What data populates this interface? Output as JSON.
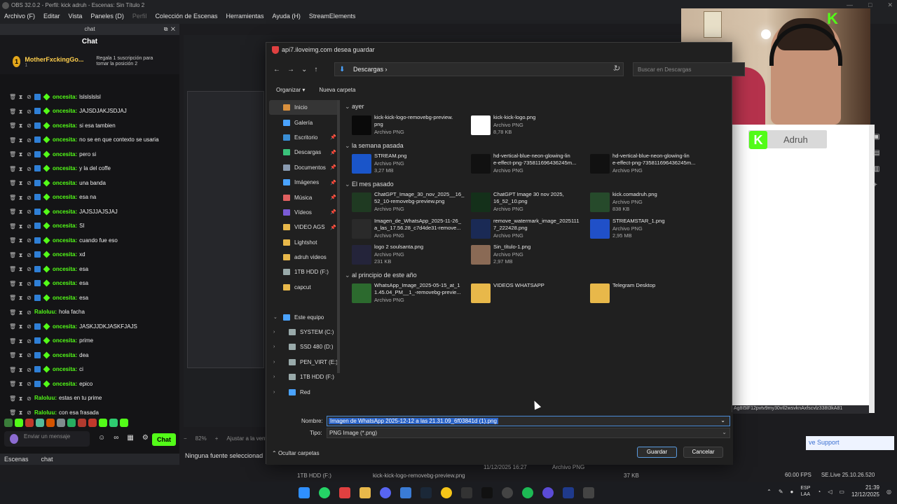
{
  "obs": {
    "title": "OBS 32.0.2 - Perfil: kick adruh - Escenas: Sin Título 2",
    "menu": [
      "Archivo (F)",
      "Editar",
      "Vista",
      "Paneles (D)",
      "Perfil",
      "Colección de Escenas",
      "Herramientas",
      "Ayuda (H)",
      "StreamElements"
    ]
  },
  "chat_dock": {
    "dock_title": "chat",
    "header": "Chat",
    "gift": {
      "user": "MotherFxckingGo...",
      "sub": "1",
      "message": "Regala 1 suscripción para tomar la posición 2"
    },
    "messages": [
      {
        "user": "oncesita:",
        "text": "lslslslslsl"
      },
      {
        "user": "oncesita:",
        "text": "JAJSDJAKJSDJAJ"
      },
      {
        "user": "oncesita:",
        "text": "si esa tambien"
      },
      {
        "user": "oncesita:",
        "text": "no se en que contexto se usaria"
      },
      {
        "user": "oncesita:",
        "text": "pero si"
      },
      {
        "user": "oncesita:",
        "text": "y la del coffe"
      },
      {
        "user": "oncesita:",
        "text": "una banda"
      },
      {
        "user": "oncesita:",
        "text": "esa na"
      },
      {
        "user": "oncesita:",
        "text": "JAJSJJAJSJAJ"
      },
      {
        "user": "oncesita:",
        "text": "SI"
      },
      {
        "user": "oncesita:",
        "text": "cuando fue eso"
      },
      {
        "user": "oncesita:",
        "text": "xd"
      },
      {
        "user": "oncesita:",
        "text": "esa"
      },
      {
        "user": "oncesita:",
        "text": "esa"
      },
      {
        "user": "oncesita:",
        "text": "esa"
      },
      {
        "user": "Raloluu:",
        "text": "hola facha"
      },
      {
        "user": "oncesita:",
        "text": "JASKJJDKJASKFJAJS"
      },
      {
        "user": "oncesita:",
        "text": "prime"
      },
      {
        "user": "oncesita:",
        "text": "dea"
      },
      {
        "user": "oncesita:",
        "text": "ci"
      },
      {
        "user": "oncesita:",
        "text": "epico"
      },
      {
        "user": "Raloluu:",
        "text": "estas en tu prime"
      },
      {
        "user": "Raloluu:",
        "text": "con esa frasada"
      }
    ],
    "input_placeholder": "Enviar un mensaje",
    "send_label": "Chat",
    "tabs": [
      "Escenas",
      "chat"
    ]
  },
  "preview": {
    "zoom": "82%",
    "fit_label": "Ajustar a la venta",
    "no_source": "Ninguna fuente seleccionad"
  },
  "right_panel": {
    "kick_name": "Adruh",
    "hash": "Ag8I5lF12pvtv9my30vIl2wsvknAxfscvlz338t3kA81",
    "support": "ve Support"
  },
  "stats": {
    "fps": "60.00 FPS",
    "version": "SE.Live 25.10.26.520"
  },
  "dialog": {
    "title": "api7.iloveimg.com desea guardar",
    "path": "Descargas",
    "search_placeholder": "Buscar en Descargas",
    "organize": "Organizar",
    "new_folder": "Nueva carpeta",
    "nav": [
      {
        "label": "Inicio",
        "icon": "home-icon",
        "pin": false
      },
      {
        "label": "Galería",
        "icon": "gallery-icon",
        "pin": false
      },
      {
        "label": "Escritorio",
        "icon": "desktop-icon",
        "pin": true
      },
      {
        "label": "Descargas",
        "icon": "download-icon",
        "pin": true
      },
      {
        "label": "Documentos",
        "icon": "documents-icon",
        "pin": true
      },
      {
        "label": "Imágenes",
        "icon": "pictures-icon",
        "pin": true
      },
      {
        "label": "Música",
        "icon": "music-icon",
        "pin": true
      },
      {
        "label": "Vídeos",
        "icon": "videos-icon",
        "pin": true
      },
      {
        "label": "VIDEO AGS",
        "icon": "folder-icon",
        "pin": true
      },
      {
        "label": "Lightshot",
        "icon": "folder-icon",
        "pin": false
      },
      {
        "label": "adruh videos",
        "icon": "folder-icon",
        "pin": false
      },
      {
        "label": "1TB HDD (F:)",
        "icon": "drive-icon",
        "pin": false
      },
      {
        "label": "capcut",
        "icon": "folder-icon",
        "pin": false
      },
      {
        "label": "",
        "icon": "",
        "pin": false
      },
      {
        "label": "Este equipo",
        "icon": "computer-icon",
        "pin": false
      },
      {
        "label": "SYSTEM (C:)",
        "icon": "drive-icon",
        "pin": false
      },
      {
        "label": "SSD 480 (D:)",
        "icon": "drive-icon",
        "pin": false
      },
      {
        "label": "PEN_VIRT (E:)",
        "icon": "drive-icon",
        "pin": false
      },
      {
        "label": "1TB HDD (F:)",
        "icon": "drive-icon",
        "pin": false
      },
      {
        "label": "Red",
        "icon": "network-icon",
        "pin": false
      }
    ],
    "groups": [
      {
        "label": "ayer"
      },
      {
        "label": "la semana pasada"
      },
      {
        "label": "El mes pasado"
      },
      {
        "label": "al principio de este año"
      }
    ],
    "files": [
      {
        "name": "kick-kick-logo-removebg-preview.\npng",
        "type": "Archivo PNG",
        "size": "",
        "color": "#0a0a0a"
      },
      {
        "name": "kick-kick-logo.png",
        "type": "Archivo PNG",
        "size": "8,78 KB",
        "color": "#ffffff"
      },
      {
        "name": "STREAM.png",
        "type": "Archivo PNG",
        "size": "3,27 MB",
        "color": "#1a55c9"
      },
      {
        "name": "hd-vertical-blue-neon-glowing-lin\ne-effect-png-735811696436245m...",
        "type": "Archivo PNG",
        "size": "",
        "color": "#111111"
      },
      {
        "name": "hd-vertical-blue-neon-glowing-lin\ne-effect-png-735811696436245m...",
        "type": "Archivo PNG",
        "size": "",
        "color": "#111111"
      },
      {
        "name": "ChatGPT_Image_30_nov_2025__16_\n52_10-removebg-preview.png",
        "type": "Archivo PNG",
        "size": "",
        "color": "#1f3a22"
      },
      {
        "name": "ChatGPT Image 30 nov 2025,\n16_52_10.png",
        "type": "Archivo PNG",
        "size": "",
        "color": "#14301a"
      },
      {
        "name": "kick.comadruh.png",
        "type": "Archivo PNG",
        "size": "838 KB",
        "color": "#264a2b"
      },
      {
        "name": "Imagen_de_WhatsApp_2025-11-26_\na_las_17.56.28_c7d4de31-remove...",
        "type": "Archivo PNG",
        "size": "",
        "color": "#2a2a2a"
      },
      {
        "name": "remove_watermark_image_2025111\n7_222428.png",
        "type": "Archivo PNG",
        "size": "",
        "color": "#1a2a55"
      },
      {
        "name": "STREAMSTAR_1.png",
        "type": "Archivo PNG",
        "size": "2,95 MB",
        "color": "#2050c8"
      },
      {
        "name": "logo 2 soulsanta.png",
        "type": "Archivo PNG",
        "size": "231 KB",
        "color": "#24243a"
      },
      {
        "name": "Sin_título-1.png",
        "type": "Archivo PNG",
        "size": "2,97 MB",
        "color": "#8a6a55"
      },
      {
        "name": "WhatsApp_Image_2025-05-15_at_1\n1.45.04_PM__1_-removebg-previe...",
        "type": "Archivo PNG",
        "size": "",
        "color": "#2c6a2e"
      },
      {
        "name": "VIDEOS WHATSAPP",
        "type": "",
        "size": "",
        "color": "#e8b84a"
      },
      {
        "name": "Telegram Desktop",
        "type": "",
        "size": "",
        "color": "#e8b84a"
      }
    ],
    "name_label": "Nombre:",
    "name_value": "Imagen de WhatsApp 2025-12-12 a las 21.31.09_6f03841d (1).png",
    "type_label": "Tipo:",
    "type_value": "PNG Image (*.png)",
    "hide_folders": "Ocultar carpetas",
    "save": "Guardar",
    "cancel": "Cancelar"
  },
  "behind": {
    "drive": "1TB HDD (F:)",
    "file": "kick-kick-logo-removebg-preview.png",
    "date": "11/12/2025 16:27",
    "type": "Archivo PNG",
    "size": "37 KB"
  },
  "taskbar": {
    "lang1": "ESP",
    "lang2": "LAA",
    "time": "21:39",
    "date": "12/12/2025"
  },
  "colors": {
    "kick_green": "#53fc18",
    "accent_blue": "#2a63c7"
  }
}
